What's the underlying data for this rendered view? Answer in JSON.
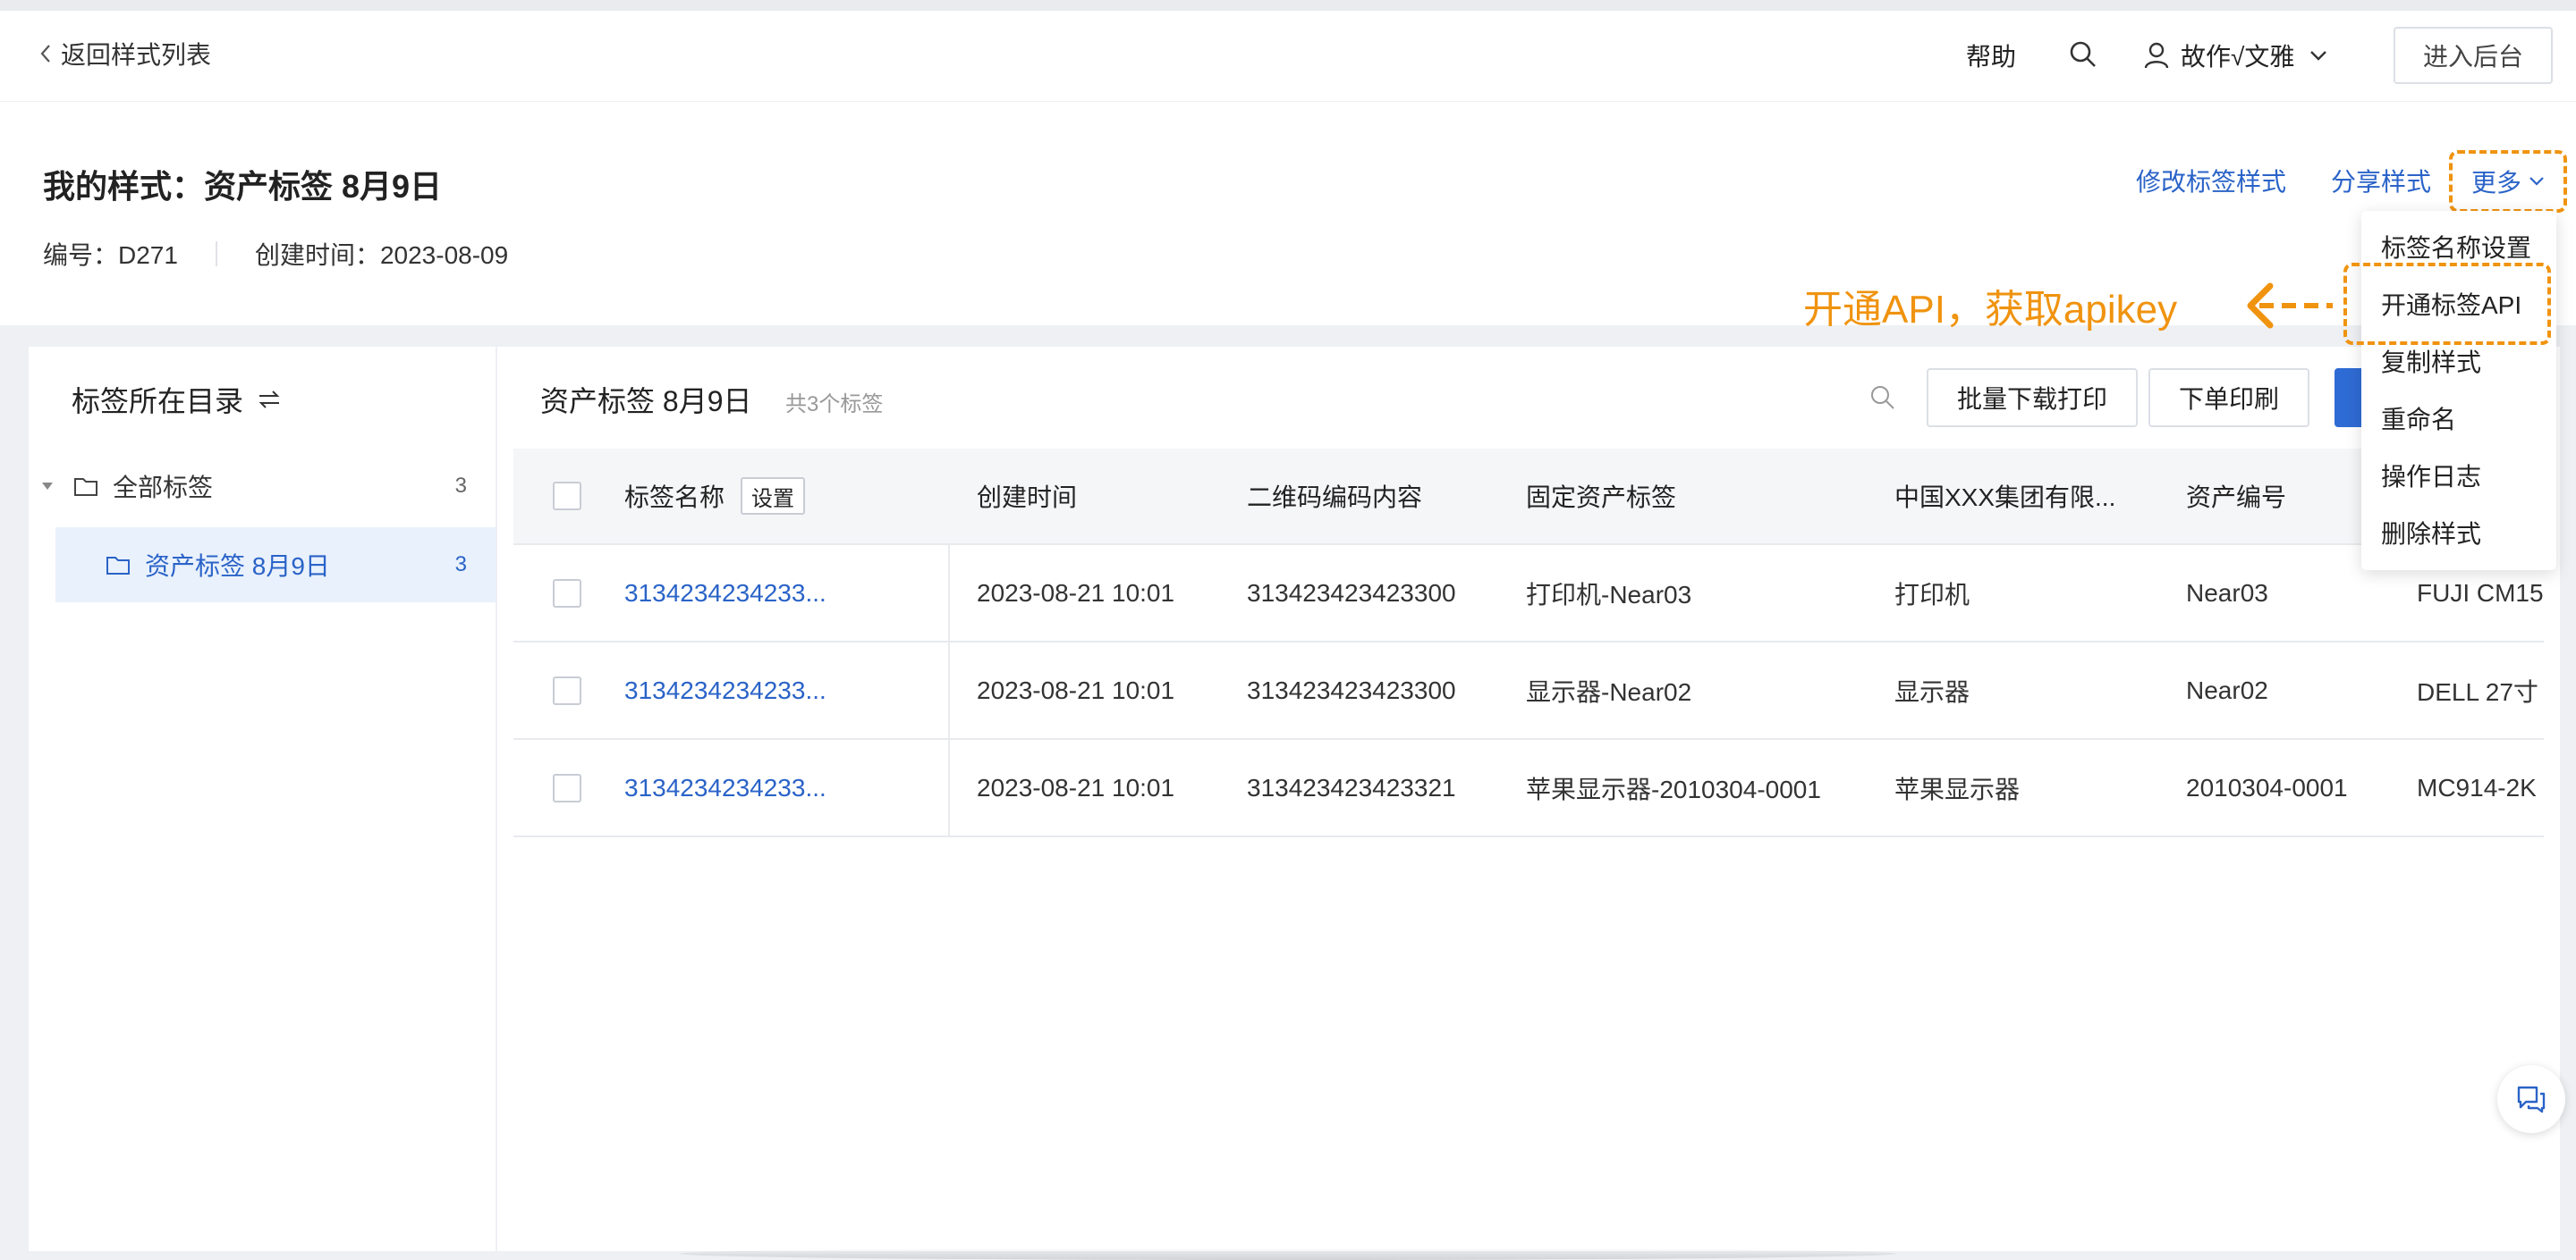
{
  "topbar": {
    "back_label": "返回样式列表",
    "help_label": "帮助",
    "user_name": "故作√文雅",
    "backend_label": "进入后台"
  },
  "header": {
    "title": "我的样式：资产标签 8月9日",
    "code": "编号：D271",
    "created": "创建时间：2023-08-09",
    "actions": {
      "modify": "修改标签样式",
      "share": "分享样式",
      "more": "更多"
    }
  },
  "sidebar": {
    "title": "标签所在目录",
    "root": {
      "label": "全部标签",
      "count": "3"
    },
    "child": {
      "label": "资产标签 8月9日",
      "count": "3"
    }
  },
  "main": {
    "title": "资产标签 8月9日",
    "count_label": "共3个标签",
    "batch_label": "批量下载打印",
    "order_label": "下单印刷"
  },
  "table": {
    "headers": [
      "标签名称",
      "创建时间",
      "二维码编码内容",
      "固定资产标签",
      "中国XXX集团有限...",
      "资产编号"
    ],
    "settings_label": "设置",
    "rows": [
      [
        "3134234234233...",
        "2023-08-21 10:01",
        "313423423423300",
        "打印机-Near03",
        "打印机",
        "Near03",
        "FUJI CM15"
      ],
      [
        "3134234234233...",
        "2023-08-21 10:01",
        "313423423423300",
        "显示器-Near02",
        "显示器",
        "Near02",
        "DELL 27寸"
      ],
      [
        "3134234234233...",
        "2023-08-21 10:01",
        "313423423423321",
        "苹果显示器-2010304-0001",
        "苹果显示器",
        "2010304-0001",
        "MC914-2K"
      ]
    ]
  },
  "dropdown": {
    "items": [
      "标签名称设置",
      "开通标签API",
      "复制样式",
      "重命名",
      "操作日志",
      "删除样式"
    ]
  },
  "annotation": {
    "text": "开通API，获取apikey",
    "color": "#f0930f"
  },
  "colors": {
    "accent": "#2a63c8",
    "highlight": "#f0930f"
  }
}
